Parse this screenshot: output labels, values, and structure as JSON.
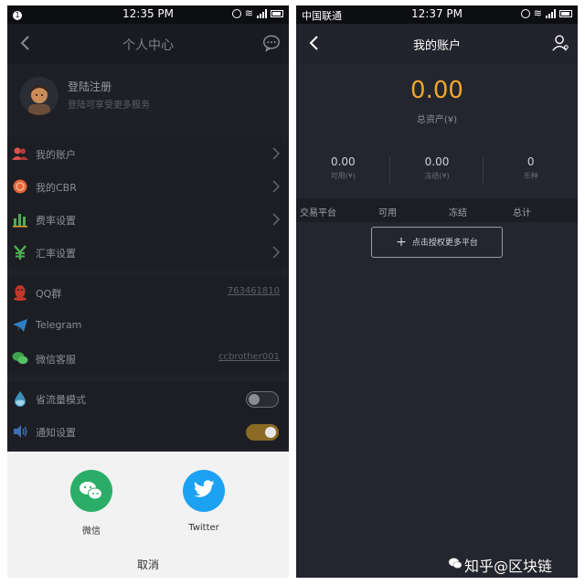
{
  "left_screen": {
    "status": {
      "time": "12:35 PM"
    },
    "header": {
      "title": "个人中心"
    },
    "profile": {
      "name": "登陆注册",
      "subtitle": "登陆可享受更多服务"
    },
    "menu": [
      {
        "label": "我的账户",
        "icon": "user-group-icon",
        "color": "#d9534f"
      },
      {
        "label": "我的CBR",
        "icon": "coin-icon",
        "color": "#e2663a"
      },
      {
        "label": "费率设置",
        "icon": "bar-chart-icon",
        "color": "#4caf50"
      },
      {
        "label": "汇率设置",
        "icon": "yen-icon",
        "color": "#4caf50"
      }
    ],
    "contacts": [
      {
        "label": "QQ群",
        "value": "763461810",
        "icon": "qq-penguin-icon",
        "color": "#c0392b"
      },
      {
        "label": "Telegram",
        "value": "",
        "icon": "telegram-plane-icon",
        "color": "#2f7fc1"
      },
      {
        "label": "微信客服",
        "value": "ccbrother001",
        "icon": "wechat-bubble-icon",
        "color": "#3fa34d"
      }
    ],
    "settings": [
      {
        "label": "省流量模式",
        "on": false,
        "icon": "water-drop-icon",
        "color": "#3d8fb8"
      },
      {
        "label": "通知设置",
        "on": true,
        "icon": "speaker-icon",
        "color": "#3d6fb8"
      }
    ],
    "share_sheet": {
      "options": [
        {
          "label": "微信",
          "color": "#2aae67",
          "icon": "wechat-icon"
        },
        {
          "label": "Twitter",
          "color": "#1da1f2",
          "icon": "twitter-bird-icon"
        }
      ],
      "cancel": "取消"
    }
  },
  "right_screen": {
    "status": {
      "carrier": "中国联通",
      "time": "12:37 PM"
    },
    "header": {
      "title": "我的账户"
    },
    "total": {
      "amount": "0.00",
      "label": "总资产(¥)"
    },
    "stats": [
      {
        "value": "0.00",
        "label": "可用(¥)"
      },
      {
        "value": "0.00",
        "label": "冻结(¥)"
      },
      {
        "value": "0",
        "label": "币种"
      }
    ],
    "table_headers": [
      "交易平台",
      "可用",
      "冻结",
      "总计"
    ],
    "auth_button": "点击授权更多平台"
  },
  "watermark": "知乎@区块链"
}
